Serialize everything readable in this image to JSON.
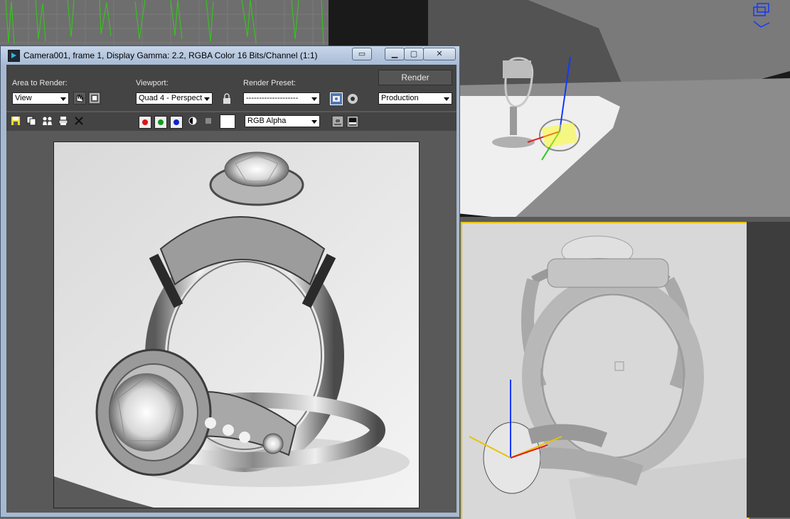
{
  "window": {
    "title": "Camera001, frame 1, Display Gamma: 2.2, RGBA Color 16 Bits/Channel (1:1)",
    "controls": {
      "minimize": "▁",
      "maximize": "▢",
      "close": "✕"
    }
  },
  "render_controls": {
    "area_label": "Area to Render:",
    "area_value": "View",
    "viewport_label": "Viewport:",
    "viewport_value": "Quad 4 - Perspect",
    "preset_label": "Render Preset:",
    "preset_value": "--------------------",
    "render_button": "Render",
    "mode_value": "Production",
    "channel_display_value": "RGB Alpha"
  },
  "icons": [
    "save-icon",
    "copy-icon",
    "clone-icon",
    "print-icon",
    "clear-icon",
    "red-channel-icon",
    "green-channel-icon",
    "blue-channel-icon",
    "monochrome-icon",
    "alpha-icon",
    "color-swatch-icon",
    "region-icon",
    "crop-icon",
    "lock-icon",
    "render-setup-icon",
    "environment-icon",
    "viewport-toggle-icon",
    "display-toggle-icon"
  ],
  "colors": {
    "viewport_highlight": "#e6c400",
    "titlebar": "#b8cadf",
    "panel": "#444444"
  }
}
